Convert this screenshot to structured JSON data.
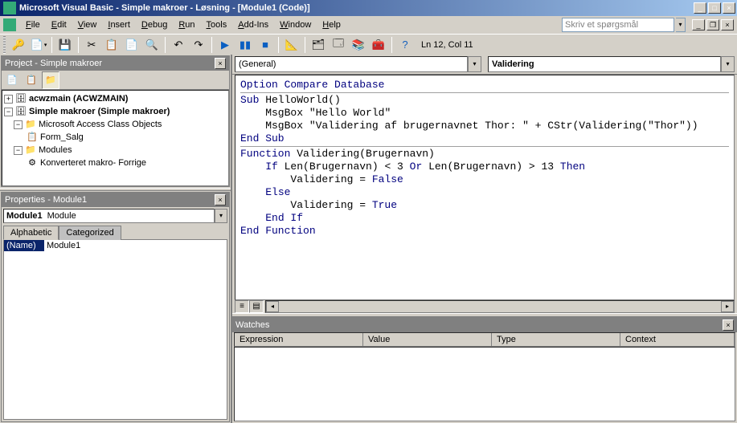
{
  "title": "Microsoft Visual Basic - Simple makroer - Løsning - [Module1 (Code)]",
  "menu": {
    "file": "File",
    "edit": "Edit",
    "view": "View",
    "insert": "Insert",
    "debug": "Debug",
    "run": "Run",
    "tools": "Tools",
    "addins": "Add-Ins",
    "window": "Window",
    "help": "Help"
  },
  "ask_placeholder": "Skriv et spørgsmål",
  "cursor_status": "Ln 12, Col 11",
  "project": {
    "title": "Project - Simple makroer",
    "tree": {
      "db1": "acwzmain (ACWZMAIN)",
      "db2": "Simple makroer (Simple makroer)",
      "folder1": "Microsoft Access Class Objects",
      "form1": "Form_Salg",
      "folder2": "Modules",
      "mod1": "Konverteret makro- Forrige"
    }
  },
  "properties": {
    "title": "Properties - Module1",
    "object_name": "Module1",
    "object_type": "Module",
    "tab_alpha": "Alphabetic",
    "tab_cat": "Categorized",
    "prop_name_label": "(Name)",
    "prop_name_value": "Module1"
  },
  "code": {
    "combo_left": "(General)",
    "combo_right": "Validering",
    "lines": [
      {
        "t": "kw",
        "text": "Option Compare Database"
      },
      {
        "t": "hr"
      },
      {
        "t": "mix",
        "parts": [
          {
            "kw": "Sub"
          },
          {
            "p": " HelloWorld()"
          }
        ]
      },
      {
        "t": "mix",
        "parts": [
          {
            "p": "    MsgBox "
          },
          {
            "s": "\"Hello World\""
          }
        ]
      },
      {
        "t": "mix",
        "parts": [
          {
            "p": "    MsgBox "
          },
          {
            "s": "\"Validering af brugernavnet Thor: \""
          },
          {
            "p": " + CStr(Validering("
          },
          {
            "s": "\"Thor\""
          },
          {
            "p": "))"
          }
        ]
      },
      {
        "t": "kw",
        "text": "End Sub"
      },
      {
        "t": "hr"
      },
      {
        "t": "mix",
        "parts": [
          {
            "kw": "Function"
          },
          {
            "p": " Validering(Brugernavn)"
          }
        ]
      },
      {
        "t": "mix",
        "parts": [
          {
            "p": "    "
          },
          {
            "kw": "If"
          },
          {
            "p": " Len(Brugernavn) < 3 "
          },
          {
            "kw": "Or"
          },
          {
            "p": " Len(Brugernavn) > 13 "
          },
          {
            "kw": "Then"
          }
        ]
      },
      {
        "t": "mix",
        "parts": [
          {
            "p": "        Validering = "
          },
          {
            "kw": "False"
          }
        ]
      },
      {
        "t": "mix",
        "parts": [
          {
            "p": "    "
          },
          {
            "kw": "Else"
          }
        ]
      },
      {
        "t": "mix",
        "parts": [
          {
            "p": "        Validering = "
          },
          {
            "kw": "True"
          }
        ]
      },
      {
        "t": "mix",
        "parts": [
          {
            "p": "    "
          },
          {
            "kw": "End If"
          }
        ]
      },
      {
        "t": "kw",
        "text": "End Function"
      }
    ]
  },
  "watches": {
    "title": "Watches",
    "col1": "Expression",
    "col2": "Value",
    "col3": "Type",
    "col4": "Context"
  }
}
